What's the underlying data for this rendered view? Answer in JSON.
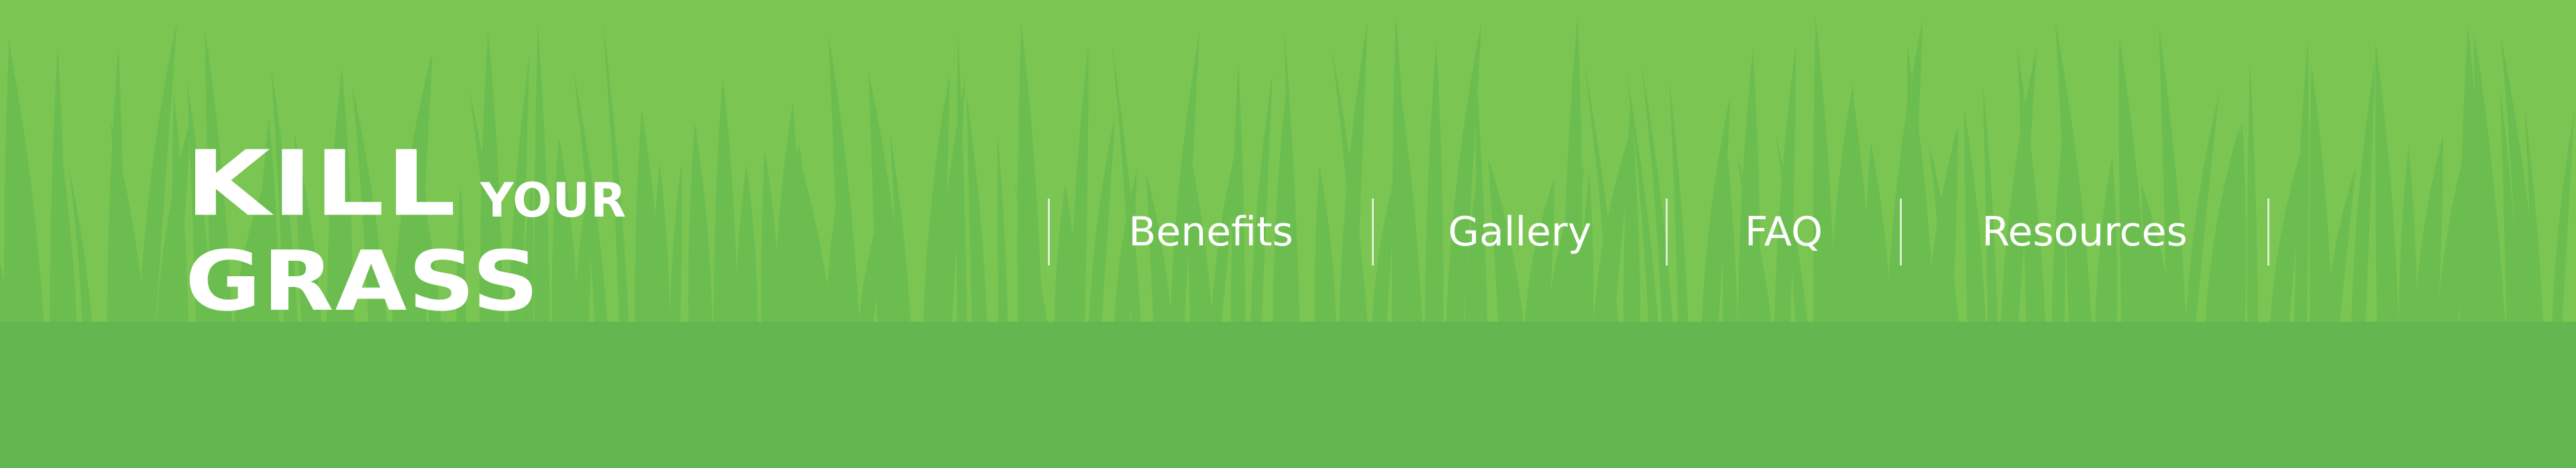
{
  "brand": {
    "line1": "KILL",
    "line1_small": "YOUR",
    "line2": "GRASS"
  },
  "nav": {
    "items": [
      {
        "label": "Benefits"
      },
      {
        "label": "Gallery"
      },
      {
        "label": "FAQ"
      },
      {
        "label": "Resources"
      }
    ]
  },
  "colors": {
    "upper_background": "#7bc553",
    "lower_background": "#63b650",
    "grass_blades": "#6bbd50",
    "text": "#ffffff"
  }
}
